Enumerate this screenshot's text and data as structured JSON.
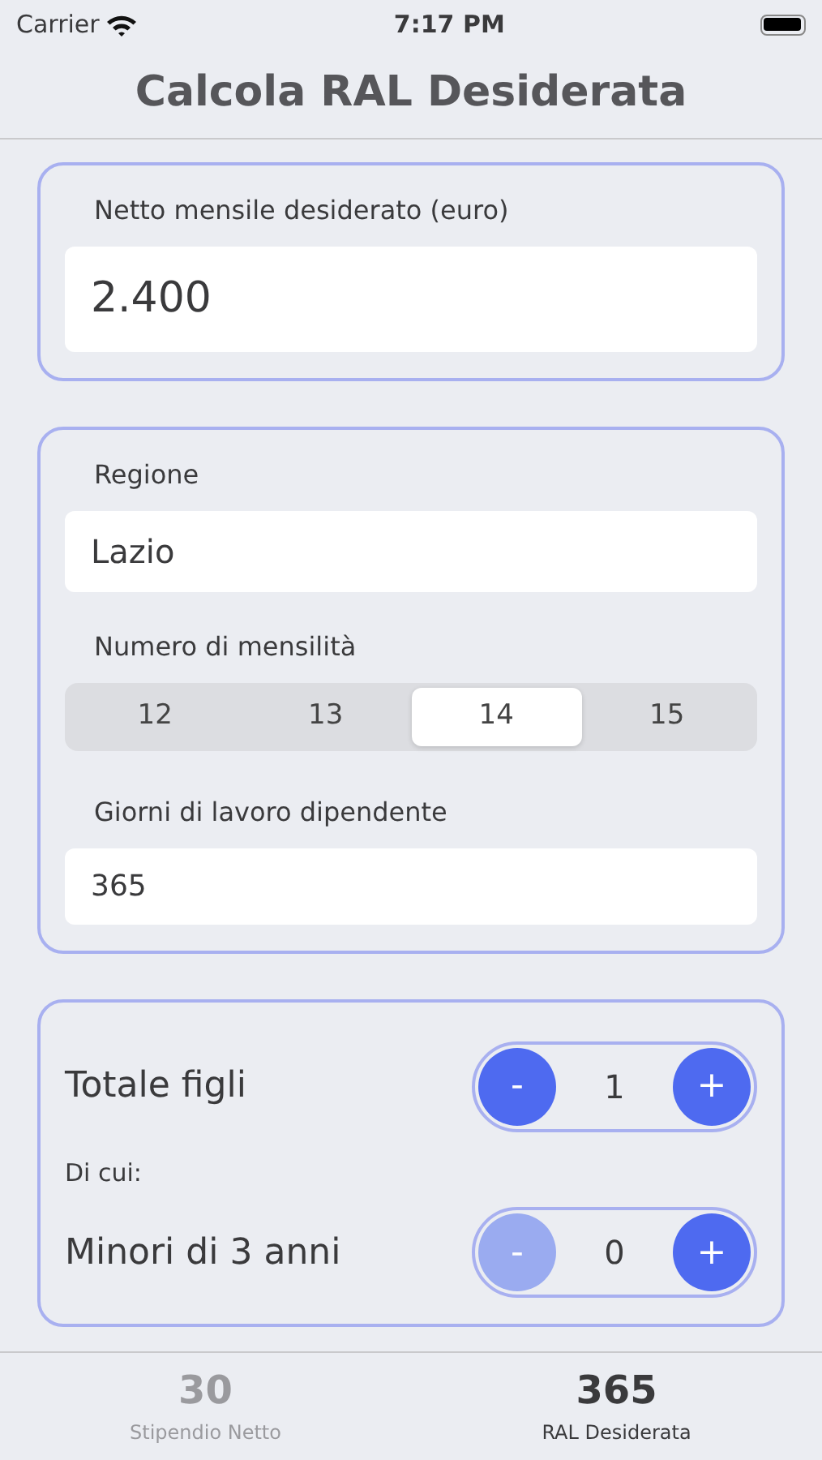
{
  "status_bar": {
    "carrier": "Carrier",
    "time": "7:17 PM"
  },
  "title": "Calcola RAL Desiderata",
  "net_card": {
    "label": "Netto mensile desiderato (euro)",
    "value": "2.400"
  },
  "details_card": {
    "region_label": "Regione",
    "region_value": "Lazio",
    "months_label": "Numero di mensilità",
    "months": [
      {
        "label": "12",
        "selected": false
      },
      {
        "label": "13",
        "selected": false
      },
      {
        "label": "14",
        "selected": true
      },
      {
        "label": "15",
        "selected": false
      }
    ],
    "days_label": "Giorni di lavoro dipendente",
    "days_value": "365"
  },
  "children_card": {
    "total_label": "Totale figli",
    "total_stepper": {
      "minus": "-",
      "value": "1",
      "plus": "+",
      "minus_disabled": false
    },
    "of_which": "Di cui:",
    "under3_label": "Minori di 3 anni",
    "under3_stepper": {
      "minus": "-",
      "value": "0",
      "plus": "+",
      "minus_disabled": true
    }
  },
  "tabs": [
    {
      "value": "30",
      "label": "Stipendio Netto",
      "selected": false
    },
    {
      "value": "365",
      "label": "RAL Desiderata",
      "selected": true
    }
  ]
}
